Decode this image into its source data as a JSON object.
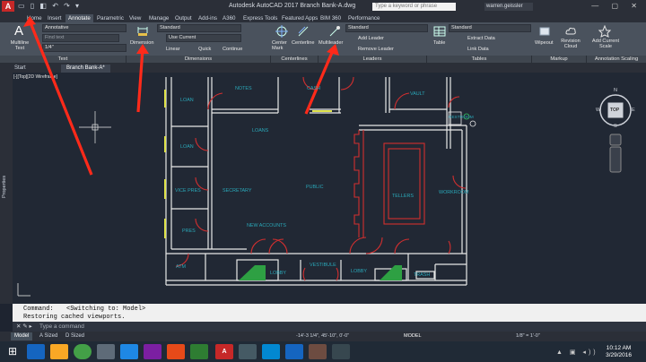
{
  "title_bar": {
    "app_icon": "A",
    "title": "Autodesk AutoCAD 2017  Branch Bank-A.dwg",
    "search_placeholder": "Type a keyword or phrase",
    "user": "warren.geissler"
  },
  "ribbon_tabs": [
    "Home",
    "Insert",
    "Annotate",
    "Parametric",
    "View",
    "Manage",
    "Output",
    "Add-ins",
    "A360",
    "Express Tools",
    "Featured Apps",
    "BIM 360",
    "Performance"
  ],
  "ribbon": {
    "text_panel": {
      "multiline_text": "Multiline Text",
      "text_style": "Annotative",
      "find_text": "Find text",
      "text_height": "1/4\"",
      "title": "Text"
    },
    "dimensions_panel": {
      "dimension": "Dimension",
      "dim_style": "Standard",
      "use_current": "Use Current",
      "linear": "Linear",
      "quick": "Quick",
      "continue": "Continue",
      "title": "Dimensions"
    },
    "centerlines_panel": {
      "center_mark": "Center Mark",
      "centerline": "Centerline",
      "title": "Centerlines"
    },
    "leaders_panel": {
      "multileader": "Multileader",
      "leader_style": "Standard",
      "add_leader": "Add Leader",
      "remove_leader": "Remove Leader",
      "title": "Leaders"
    },
    "tables_panel": {
      "table": "Table",
      "table_style": "Standard",
      "extract_data": "Extract Data",
      "link_data": "Link Data",
      "title": "Tables"
    },
    "markup_panel": {
      "wipeout": "Wipeout",
      "revision_cloud": "Revision Cloud",
      "title": "Markup"
    },
    "annotation_scaling_panel": {
      "add_current_scale": "Add Current Scale",
      "title": "Annotation Scaling"
    }
  },
  "doc_tabs": [
    "Start",
    "Branch Bank-A*"
  ],
  "view_label": "[-][Top][2D Wireframe]",
  "properties_label": "Properties",
  "viewcube": {
    "top": "TOP",
    "n": "N",
    "s": "S",
    "e": "E",
    "w": "W"
  },
  "rooms": [
    "LOAN",
    "NOTES",
    "CASH",
    "VAULT",
    "RESTROOM",
    "LOAN",
    "LOANS",
    "VICE PRES",
    "SECRETARY",
    "PUBLIC",
    "TELLERS",
    "WORKROOM",
    "PRES",
    "NEW ACCOUNTS",
    "ATM",
    "VESTIBULE",
    "LOBBY",
    "LOBBY",
    "TRASH"
  ],
  "command": {
    "line1_label": "Command:",
    "line1_text": "<Switching to: Model>",
    "line2": "Restoring cached viewports.",
    "placeholder": "Type a command"
  },
  "layout_tabs": [
    "Model",
    "A Sized",
    "D Sized"
  ],
  "status": {
    "coords": "-14'-3 1/4\", 45'-10\", 0'-0\"",
    "model": "MODEL",
    "scale": "1/8\" = 1'-0\""
  },
  "clock": {
    "time": "10:12 AM",
    "date": "3/29/2016"
  },
  "colors": {
    "accent_red": "#ff2a1a",
    "room_text": "#2aa7b8",
    "wall": "#ffffff",
    "door": "#d32f2f"
  }
}
